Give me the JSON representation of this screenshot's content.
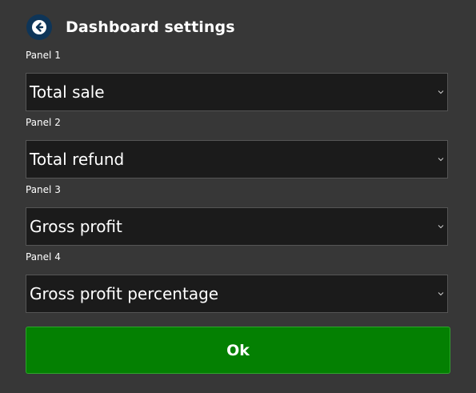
{
  "header": {
    "back_icon": "arrow-left-circle-icon",
    "title": "Dashboard settings"
  },
  "panels": [
    {
      "label": "Panel 1",
      "value": "Total sale"
    },
    {
      "label": "Panel 2",
      "value": "Total refund"
    },
    {
      "label": "Panel 3",
      "value": "Gross profit"
    },
    {
      "label": "Panel 4",
      "value": "Gross profit percentage"
    }
  ],
  "ok_button": {
    "label": "Ok"
  },
  "colors": {
    "background": "#373737",
    "select_background": "#1b1b1b",
    "ok_button": "#048002",
    "back_button": "#0e3558"
  }
}
